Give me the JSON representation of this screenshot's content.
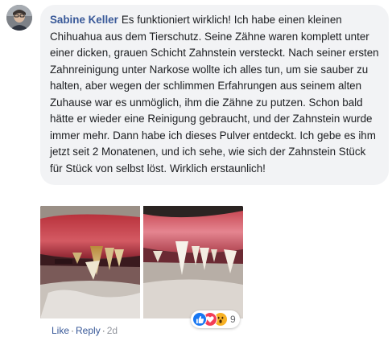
{
  "comment": {
    "author": "Sabine Keller",
    "text": "Es funktioniert wirklich! Ich habe einen kleinen Chihuahua aus dem Tierschutz. Seine Zähne waren komplett unter einer dicken, grauen Schicht Zahnstein versteckt. Nach seiner ersten Zahnreinigung unter Narkose wollte ich alles tun, um sie sauber zu halten, aber wegen der schlimmen Erfahrungen aus seinem alten Zuhause war es unmöglich, ihm die Zähne zu putzen. Schon bald hätte er wieder eine Reinigung gebraucht, und der Zahnstein wurde immer mehr. Dann habe ich dieses Pulver entdeckt. Ich gebe es ihm jetzt seit 2 Monatenen, und ich sehe, wie sich der Zahnstein Stück für Stück von selbst löst. Wirklich erstaunlich!"
  },
  "reactions": {
    "icons": [
      "like-icon",
      "love-icon",
      "wow-icon"
    ],
    "count": "9",
    "colors": {
      "like": "#1877f2",
      "love": "#f33e58",
      "wow": "#f7b125"
    }
  },
  "actions": {
    "like_label": "Like",
    "separator": "·",
    "reply_label": "Reply",
    "timestamp": "2d"
  },
  "theme": {
    "bubble_bg": "#f2f3f5",
    "author_color": "#385898",
    "meta_color": "#65676b"
  }
}
